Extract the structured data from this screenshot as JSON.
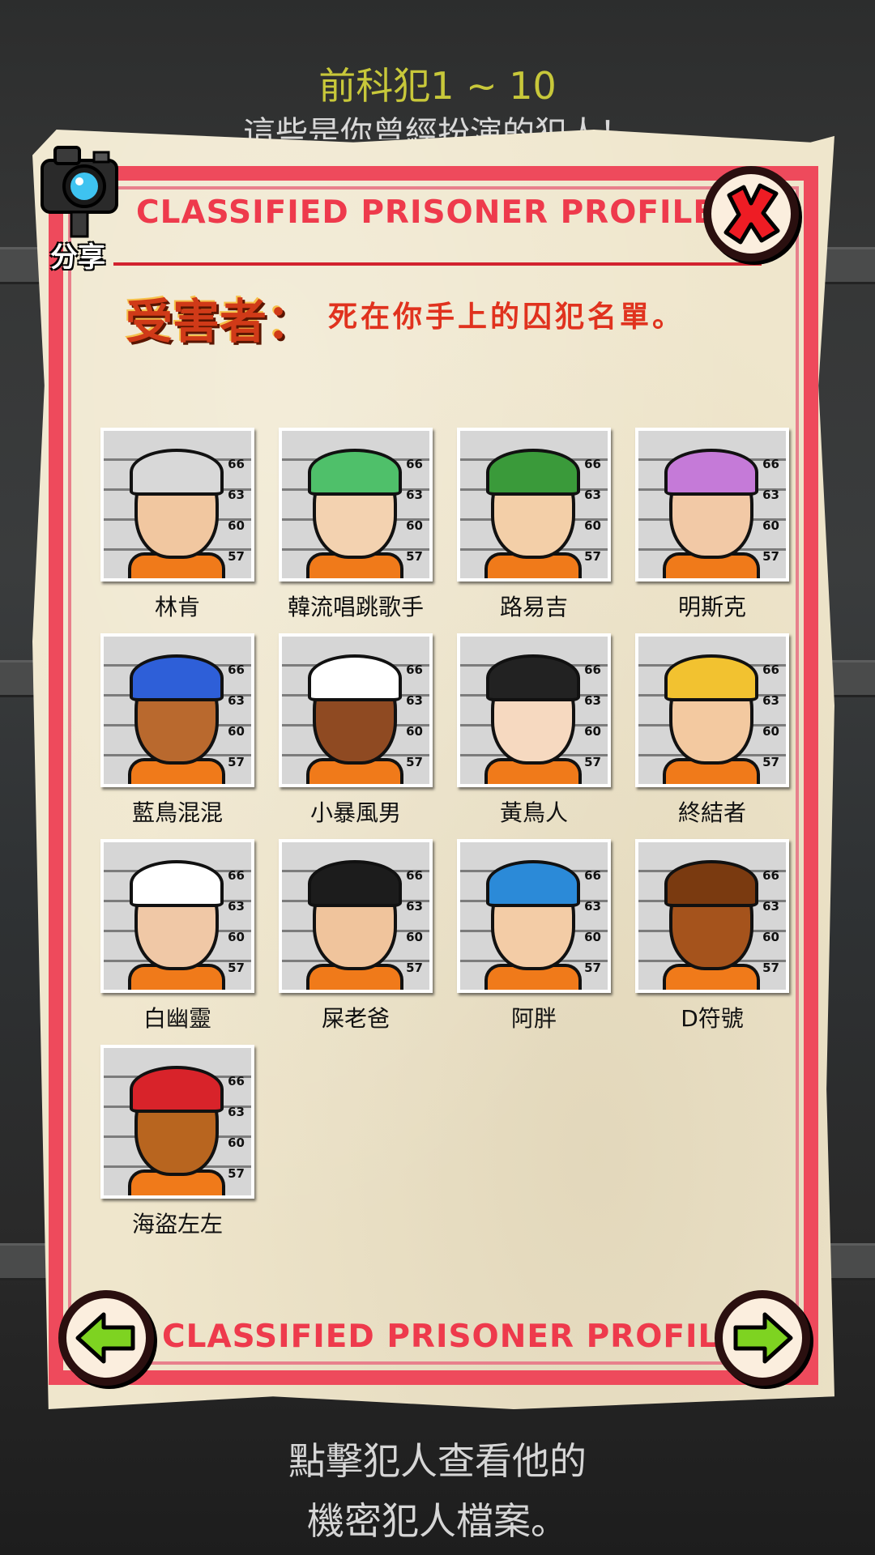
{
  "top": {
    "title": "前科犯1 ~ 10",
    "subtitle": "這些是你曾經扮演的犯人！"
  },
  "share": {
    "label": "分享",
    "icon": "camera-icon"
  },
  "header": {
    "title": "CLASSIFIED PRISONER PROFILE"
  },
  "footer": {
    "title": "CLASSIFIED PRISONER PROFILE"
  },
  "victims": {
    "label": "受害者：",
    "description": "死在你手上的囚犯名單。"
  },
  "mugshot": {
    "height_marks": [
      "66",
      "63",
      "60",
      "57"
    ]
  },
  "prisoners": [
    {
      "name": "林肯",
      "skin": "#f1c7a0",
      "hair": "#d8d8d8"
    },
    {
      "name": "韓流唱跳歌手",
      "skin": "#f3d2b0",
      "hair": "#4fc06a"
    },
    {
      "name": "路易吉",
      "skin": "#f3cfa8",
      "hair": "#3a9a3a"
    },
    {
      "name": "明斯克",
      "skin": "#f2c9a6",
      "hair": "#c57ad8"
    },
    {
      "name": "藍鳥混混",
      "skin": "#b9692e",
      "hair": "#2e5fd8"
    },
    {
      "name": "小暴風男",
      "skin": "#8f4a22",
      "hair": "#ffffff"
    },
    {
      "name": "黃鳥人",
      "skin": "#f6d9c0",
      "hair": "#222222"
    },
    {
      "name": "終結者",
      "skin": "#f3c9a0",
      "hair": "#f2c230"
    },
    {
      "name": "白幽靈",
      "skin": "#f0c8a6",
      "hair": "#ffffff"
    },
    {
      "name": "屎老爸",
      "skin": "#f0c49c",
      "hair": "#1c1c1c"
    },
    {
      "name": "阿胖",
      "skin": "#f3cca6",
      "hair": "#2b8ad8"
    },
    {
      "name": "D符號",
      "skin": "#a5531c",
      "hair": "#7a3a10"
    },
    {
      "name": "海盜左左",
      "skin": "#b8651f",
      "hair": "#d8232a"
    }
  ],
  "bottom": {
    "line1": "點擊犯人查看他的",
    "line2": "機密犯人檔案。"
  },
  "buttons": {
    "close": "close-icon",
    "prev": "arrow-left-icon",
    "next": "arrow-right-icon"
  },
  "colors": {
    "frame": "#ee4a5c",
    "paper": "#efe6cc",
    "accent_green": "#7ed321"
  }
}
